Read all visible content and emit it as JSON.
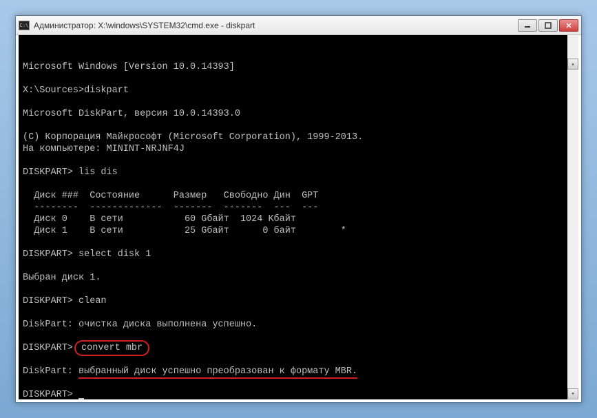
{
  "window": {
    "title": "Администратор: X:\\windows\\SYSTEM32\\cmd.exe - diskpart",
    "icon_label": "C:\\"
  },
  "console": {
    "l1": "Microsoft Windows [Version 10.0.14393]",
    "l2": "",
    "l3": "X:\\Sources>diskpart",
    "l4": "",
    "l5": "Microsoft DiskPart, версия 10.0.14393.0",
    "l6": "",
    "l7": "(C) Корпорация Майкрософт (Microsoft Corporation), 1999-2013.",
    "l8": "На компьютере: MININT-NRJNF4J",
    "l9": "",
    "l10": "DISKPART> lis dis",
    "l11": "",
    "l12": "  Диск ###  Состояние      Размер   Свободно Дин  GPT",
    "l13": "  --------  -------------  -------  -------  ---  ---",
    "l14": "  Диск 0    В сети           60 Gбайт  1024 Kбайт",
    "l15": "  Диск 1    В сети           25 Gбайт      0 байт        *",
    "l16": "",
    "l17": "DISKPART> select disk 1",
    "l18": "",
    "l19": "Выбран диск 1.",
    "l20": "",
    "l21": "DISKPART> clean",
    "l22": "",
    "l23": "DiskPart: очистка диска выполнена успешно.",
    "l24": "",
    "l25p": "DISKPART> ",
    "l25c": "convert mbr",
    "l26": "",
    "l27p": "DiskPart: ",
    "l27m": "выбранный диск успешно преобразован к формату MBR.",
    "l28": "",
    "l29": "DISKPART> "
  },
  "highlights": {
    "oval_command": "convert mbr",
    "underlined_message": "выбранный диск успешно преобразован к формату MBR."
  }
}
